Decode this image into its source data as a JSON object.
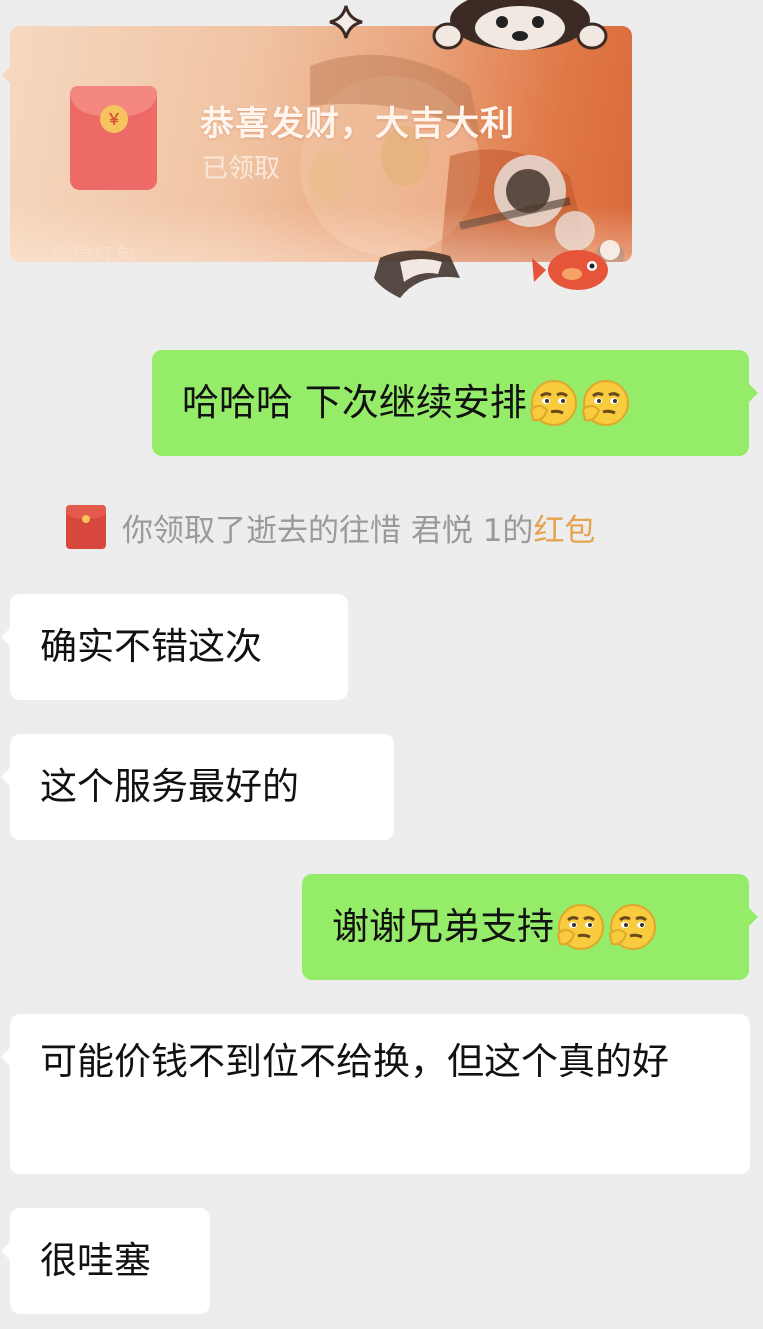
{
  "red_packet": {
    "title": "恭喜发财，大吉大利",
    "status": "已领取",
    "brand": "微信红包",
    "coin_symbol": "￥",
    "colors": {
      "envelope": "#ee6a66",
      "card_start": "#f6d8c0",
      "card_end": "#d9683a"
    }
  },
  "messages": [
    {
      "side": "right",
      "text": "哈哈哈 下次继续安排",
      "emoji": [
        "smirk-emoji",
        "smirk-emoji"
      ]
    },
    {
      "side": "system",
      "prefix": "你领取了逝去的往惜 君悦 1的",
      "link": "红包"
    },
    {
      "side": "left",
      "text": "确实不错这次"
    },
    {
      "side": "left",
      "text": "这个服务最好的"
    },
    {
      "side": "right",
      "text": "谢谢兄弟支持",
      "emoji": [
        "smirk-emoji",
        "smirk-emoji"
      ]
    },
    {
      "side": "left",
      "text": "可能价钱不到位不给换，但这个真的好"
    },
    {
      "side": "left",
      "text": "很哇塞"
    }
  ],
  "colors": {
    "background": "#ededed",
    "bubble_sent": "#95ec69",
    "bubble_received": "#ffffff",
    "notice_text": "#9a9a9a",
    "notice_link": "#e6a34f"
  }
}
